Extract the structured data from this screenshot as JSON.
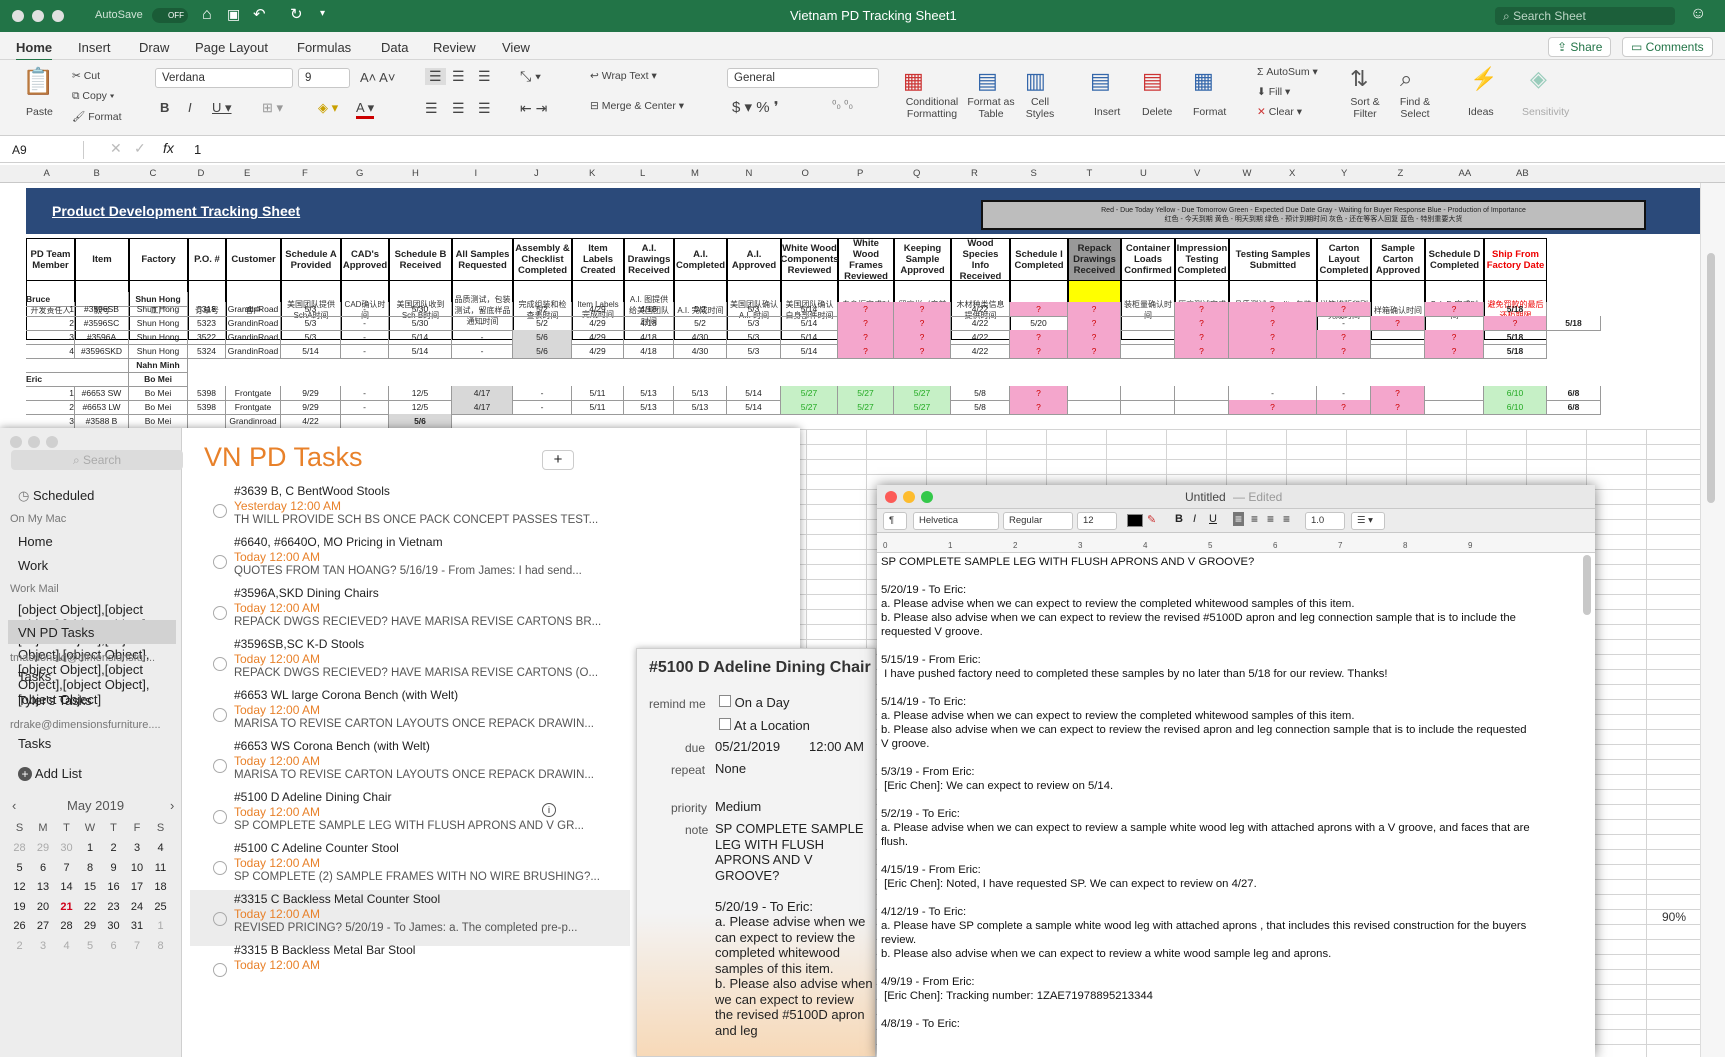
{
  "excel": {
    "title": "Vietnam PD Tracking Sheet1",
    "autosave": "AutoSave",
    "autosave_state": "OFF",
    "search_placeholder": "Search Sheet",
    "tabs": [
      "Home",
      "Insert",
      "Draw",
      "Page Layout",
      "Formulas",
      "Data",
      "Review",
      "View"
    ],
    "share": "Share",
    "comments": "Comments",
    "ribbon": {
      "paste": "Paste",
      "cut": "Cut",
      "copy": "Copy",
      "format": "Format",
      "font": "Verdana",
      "size": "9",
      "wrap": "Wrap Text",
      "merge": "Merge & Center",
      "number_format": "General",
      "cond_fmt": "Conditional Formatting",
      "fmt_table": "Format as Table",
      "cell_styles": "Cell Styles",
      "insert": "Insert",
      "delete": "Delete",
      "format2": "Format",
      "autosum": "AutoSum",
      "fill": "Fill",
      "clear": "Clear",
      "sort": "Sort & Filter",
      "find": "Find & Select",
      "ideas": "Ideas",
      "sensitivity": "Sensitivity"
    },
    "cell_ref": "A9",
    "formula_value": "1",
    "columns": [
      "A",
      "B",
      "C",
      "D",
      "E",
      "F",
      "G",
      "H",
      "I",
      "J",
      "K",
      "L",
      "M",
      "N",
      "O",
      "P",
      "Q",
      "R",
      "S",
      "T",
      "U",
      "V",
      "W",
      "X",
      "Y",
      "Z",
      "AA",
      "AB"
    ],
    "sheet_title": "Product Development Tracking Sheet",
    "legend": "Red - Due Today   Yellow - Due Tomorrow   Green - Expected Due Date   Gray - Waiting for Buyer Response   Blue - Production of Importance",
    "legend_zh": "红色 - 今天到期   黄色 - 明天到期   绿色 - 预计到期时间   灰色 - 还在等客人回复   蓝色 - 特别重要大货",
    "headers": [
      {
        "en": "PD Team Member",
        "zh": "开发责任人"
      },
      {
        "en": "Item",
        "zh": "款号"
      },
      {
        "en": "Factory",
        "zh": "工厂"
      },
      {
        "en": "P.O. #",
        "zh": "订单号"
      },
      {
        "en": "Customer",
        "zh": "客户"
      },
      {
        "en": "Schedule A Provided",
        "zh": "美国团队提供SchA时间"
      },
      {
        "en": "CAD's Approved",
        "zh": "CAD确认时间"
      },
      {
        "en": "Schedule B Received",
        "zh": "美国团队收到Sch B时间"
      },
      {
        "en": "All Samples Requested",
        "zh": "品质测试，包装测试，留底样品通知时间"
      },
      {
        "en": "Assembly & Checklist Completed",
        "zh": "完成组装和检查表时间"
      },
      {
        "en": "Item Labels Created",
        "zh": "Item Labels完成时间"
      },
      {
        "en": "A.I. Drawings Received",
        "zh": "A.I. 图提供给美国团队时间"
      },
      {
        "en": "A.I. Completed",
        "zh": "A.I. 完成时间"
      },
      {
        "en": "A.I. Approved",
        "zh": "美国团队确认A.I. 时间"
      },
      {
        "en": "White Wood Components Reviewed",
        "zh": "美国团队确认白身部件时间"
      },
      {
        "en": "White Wood Frames Reviewed",
        "zh": "白身框完成时间"
      },
      {
        "en": "Keeping Sample Approved",
        "zh": "留底样（产前样）确认时间"
      },
      {
        "en": "Wood Species Info Received",
        "zh": "木材种类信息提供时间"
      },
      {
        "en": "Schedule I Completed",
        "zh": "Sch I 完成时间"
      },
      {
        "en": "Repack Drawings Received",
        "zh": ""
      },
      {
        "en": "Container Loads Confirmed",
        "zh": "装柜量确认时间"
      },
      {
        "en": "Impression Testing Completed",
        "zh": "压痕测试完成时间"
      },
      {
        "en": "Testing Samples Submitted",
        "zh": "品质测试 Quality   包装测试 Transit"
      },
      {
        "en": "Carton Layout Completed",
        "zh": "样箱排版印刷完成时间"
      },
      {
        "en": "Sample Carton Approved",
        "zh": "样箱确认时间"
      },
      {
        "en": "Schedule D Completed",
        "zh": "Sch D 完成时间"
      },
      {
        "en": "Ship From Factory Date",
        "zh": "避免罚款的最后还柜期限"
      }
    ],
    "groups": [
      {
        "row": "20",
        "name": "Bruce",
        "factory": "Shun Hong"
      },
      {
        "row": "25",
        "name": "",
        "factory": "Nahn Minh"
      },
      {
        "row": "26",
        "name": "Eric",
        "factory": "Bo Mei"
      }
    ],
    "rows": [
      {
        "rn": "21",
        "n": "1",
        "item": "#3596SB",
        "fac": "Shun Hong",
        "po": "5318",
        "cust": "GrandinRoad",
        "c": [
          "5/3",
          "-",
          "5/30",
          "-",
          "5/2",
          "4/29",
          "4/18",
          "5/2",
          "5/3",
          "5/14",
          "?",
          "?",
          "4/22",
          "?",
          "?",
          "",
          "?",
          "?",
          "?",
          "",
          "?",
          "5/18"
        ]
      },
      {
        "rn": "22",
        "n": "2",
        "item": "#3596SC",
        "fac": "Shun Hong",
        "po": "5323",
        "cust": "GrandinRoad",
        "c": [
          "5/3",
          "-",
          "5/30",
          "-",
          "5/2",
          "4/29",
          "4/18",
          "5/2",
          "5/3",
          "5/14",
          "?",
          "?",
          "4/22",
          "5/20",
          "?",
          "",
          "?",
          "?",
          "-",
          "?",
          "",
          "?",
          "5/18"
        ]
      },
      {
        "rn": "23",
        "n": "3",
        "item": "#3596A",
        "fac": "Shun Hong",
        "po": "3522",
        "cust": "GrandinRoad",
        "c": [
          "5/3",
          "-",
          "5/14",
          "-",
          "5/6",
          "4/29",
          "4/18",
          "4/30",
          "5/3",
          "5/14",
          "?",
          "?",
          "4/22",
          "?",
          "?",
          "",
          "?",
          "?",
          "?",
          "",
          "?",
          "5/18"
        ]
      },
      {
        "rn": "24",
        "n": "4",
        "item": "#3596SKD",
        "fac": "Shun Hong",
        "po": "5324",
        "cust": "GrandinRoad",
        "c": [
          "5/14",
          "-",
          "5/14",
          "-",
          "5/6",
          "4/29",
          "4/18",
          "4/30",
          "5/3",
          "5/14",
          "?",
          "?",
          "4/22",
          "?",
          "?",
          "",
          "?",
          "?",
          "?",
          "",
          "?",
          "5/18"
        ]
      },
      {
        "rn": "27",
        "n": "1",
        "item": "#6653 SW",
        "fac": "Bo Mei",
        "po": "5398",
        "cust": "Frontgate",
        "c": [
          "9/29",
          "-",
          "12/5",
          "4/17",
          "-",
          "5/11",
          "5/13",
          "5/13",
          "5/14",
          "5/27",
          "5/27",
          "5/27",
          "5/8",
          "?",
          "",
          "",
          "",
          "-",
          "-",
          "?",
          "",
          "6/10",
          "6/8"
        ]
      },
      {
        "rn": "28",
        "n": "2",
        "item": "#6653 LW",
        "fac": "Bo Mei",
        "po": "5398",
        "cust": "Frontgate",
        "c": [
          "9/29",
          "-",
          "12/5",
          "4/17",
          "-",
          "5/11",
          "5/13",
          "5/13",
          "5/14",
          "5/27",
          "5/27",
          "5/27",
          "5/8",
          "?",
          "",
          "",
          "",
          "?",
          "?",
          "?",
          "",
          "6/10",
          "6/8"
        ]
      },
      {
        "rn": "29",
        "n": "3",
        "item": "#3588 B",
        "fac": "Bo Mei",
        "po": "",
        "cust": "Grandinroad",
        "c": [
          "4/22",
          "",
          "5/6"
        ]
      }
    ],
    "zoom": "90%",
    "right_tail": [
      "5/14",
      "5/16",
      "5/18",
      "5/16",
      "5/18",
      "5/18",
      "5/18",
      "5/21",
      "5/20"
    ]
  },
  "reminders": {
    "search_placeholder": "Search",
    "scheduled": "Scheduled",
    "on_my_mac": "On My Mac",
    "home": "Home",
    "work": "Work",
    "work_mail": "Work Mail",
    "tasks": [
      {
        "title": "#3639 B, C BentWood Stools",
        "due": "Yesterday 12:00 AM",
        "note": "TH WILL PROVIDE SCH BS ONCE PACK CONCEPT PASSES TEST..."
      },
      {
        "title": "#6640, #6640O, MO Pricing in Vietnam",
        "due": "Today 12:00 AM",
        "note": "QUOTES FROM TAN HOANG? 5/16/19 - From James: I had send..."
      },
      {
        "title": "#3596A,SKD Dining Chairs",
        "due": "Today 12:00 AM",
        "note": "REPACK DWGS RECIEVED? HAVE MARISA REVISE CARTONS BR..."
      },
      {
        "title": "#3596SB,SC K-D Stools",
        "due": "Today 12:00 AM",
        "note": "REPACK DWGS RECIEVED? HAVE MARISA REVISE CARTONS (O..."
      },
      {
        "title": "#6653 WL large Corona Bench (with Welt)",
        "due": "Today 12:00 AM",
        "note": "MARISA TO REVISE CARTON LAYOUTS ONCE REPACK DRAWIN..."
      },
      {
        "title": "#6653 WS Corona Bench (with Welt)",
        "due": "Today 12:00 AM",
        "note": "MARISA TO REVISE CARTON LAYOUTS ONCE REPACK DRAWIN..."
      },
      {
        "title": "#5100 D Adeline Dining Chair",
        "due": "Today 12:00 AM",
        "note": "SP COMPLETE SAMPLE LEG WITH FLUSH APRONS AND V GR..."
      },
      {
        "title": "#5100 C Adeline Counter Stool",
        "due": "Today 12:00 AM",
        "note": "SP COMPLETE (2) SAMPLE FRAMES WITH NO WIRE BRUSHING?..."
      },
      {
        "title": "#3315 C Backless Metal Counter Stool",
        "due": "Today 12:00 AM",
        "note": "REVISED PRICING? 5/20/19 - To James: a. The completed pre-p..."
      },
      {
        "title": "#3315 B Backless Metal Bar Stool",
        "due": "Today 12:00 AM",
        "note": ""
      }
    ],
    "vn_pd_tasks": "VN PD Tasks",
    "acct1": "tmacdonald@dimensionsfur...",
    "tasks2": "Tasks",
    "tylers": "Tyler's Tasks",
    "acct2": "rdrake@dimensionsfurniture....",
    "tasks3": "Tasks",
    "add_list": "Add List",
    "month": "May 2019",
    "dow": [
      "S",
      "M",
      "T",
      "W",
      "T",
      "F",
      "S"
    ],
    "days": [
      [
        "28",
        "29",
        "30",
        "1",
        "2",
        "3",
        "4"
      ],
      [
        "5",
        "6",
        "7",
        "8",
        "9",
        "10",
        "11"
      ],
      [
        "12",
        "13",
        "14",
        "15",
        "16",
        "17",
        "18"
      ],
      [
        "19",
        "20",
        "21",
        "22",
        "23",
        "24",
        "25"
      ],
      [
        "26",
        "27",
        "28",
        "29",
        "30",
        "31",
        "1"
      ],
      [
        "2",
        "3",
        "4",
        "5",
        "6",
        "7",
        "8"
      ]
    ],
    "list_title": "VN PD Tasks",
    "add": "+"
  },
  "detail": {
    "title": "#5100 D Adeline Dining Chair",
    "remind_me": "remind me",
    "on_day": "On a Day",
    "at_location": "At a Location",
    "due_label": "due",
    "due_date": "05/21/2019",
    "due_time": "12:00 AM",
    "repeat_label": "repeat",
    "repeat": "None",
    "priority_label": "priority",
    "priority": "Medium",
    "note_label": "note",
    "note": "SP COMPLETE SAMPLE LEG WITH FLUSH APRONS AND V GROOVE?\n\n5/20/19 - To Eric:\na. Please advise when we can expect to review the completed whitewood samples of this item.\nb. Please also advise when we can expect to review the revised #5100D apron and leg"
  },
  "textedit": {
    "title": "Untitled",
    "edited": "— Edited",
    "font": "Helvetica",
    "style": "Regular",
    "size": "12",
    "spacing": "1.0",
    "lines": [
      "SP COMPLETE SAMPLE LEG WITH FLUSH APRONS AND V GROOVE?",
      "",
      "5/20/19 - To Eric:",
      "a. Please advise when we can expect to review the completed whitewood samples of this item.",
      "b. Please also advise when we can expect to review the revised #5100D apron and leg connection sample that is to include the",
      "requested V groove.",
      "",
      "5/15/19 - From Eric:",
      " I have pushed factory need to completed these samples by no later than 5/18 for our review. Thanks!",
      "",
      "5/14/19 - To Eric:",
      "a. Please advise when we can expect to review the completed whitewood samples of this item.",
      "b. Please also advise when we can expect to review the revised apron and leg connection sample that is to include the requested",
      "V groove.",
      "",
      "5/3/19 - From Eric:",
      " [Eric Chen]: We can expect to review on 5/14.",
      "",
      "5/2/19 - To Eric:",
      "a. Please advise when we can expect to review a sample white wood leg with attached aprons with a V groove, and faces that are",
      "flush.",
      "",
      "4/15/19 - From Eric:",
      " [Eric Chen]: Noted, I have requested SP. We can expect to review on 4/27.",
      "",
      "4/12/19 - To Eric:",
      "a. Please have SP complete a sample white wood leg with attached aprons , that includes this revised construction for the buyers",
      "review.",
      "b. Please also advise when we can expect to review a white wood sample leg and aprons.",
      "",
      "4/9/19 - From Eric:",
      " [Eric Chen]: Tracking number: 1ZAE71978895213344",
      "",
      "4/8/19 - To Eric:"
    ]
  },
  "colors": {
    "excel_green": "#227447",
    "banner": "#2b4a7a",
    "due_orange": "#e8812a",
    "pink": "#f4a6cc",
    "green": "#c6f0c6",
    "today_red": "#d0021b"
  }
}
